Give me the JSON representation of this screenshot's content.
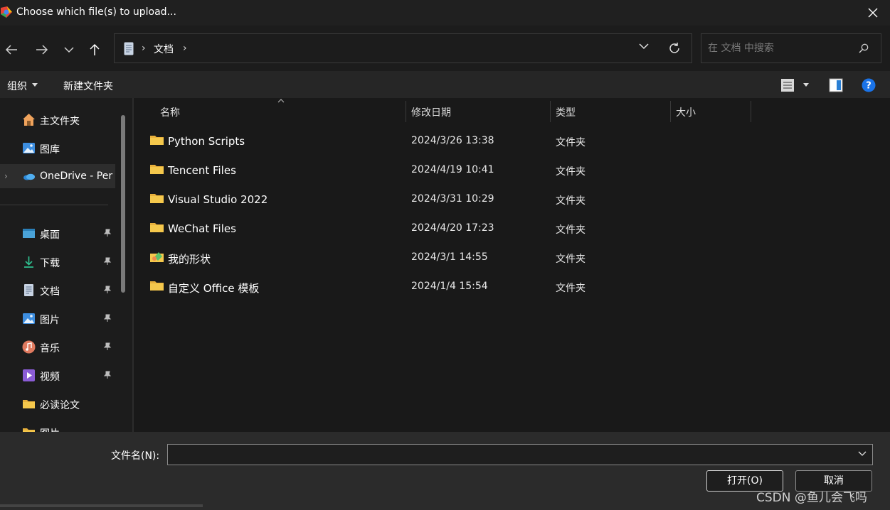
{
  "window": {
    "title": "Choose which file(s) to upload..."
  },
  "address": {
    "crumb": "文档",
    "sep": "›"
  },
  "search": {
    "placeholder": "在 文档 中搜索"
  },
  "toolbar": {
    "organize_label": "组织",
    "new_folder_label": "新建文件夹"
  },
  "sidebar": {
    "items": [
      {
        "label": "主文件夹",
        "icon": "home-icon"
      },
      {
        "label": "图库",
        "icon": "gallery-icon"
      },
      {
        "label": "OneDrive - Per",
        "icon": "onedrive-icon",
        "expander": "›"
      },
      {
        "label": "桌面",
        "icon": "desktop-icon"
      },
      {
        "label": "下载",
        "icon": "download-icon"
      },
      {
        "label": "文档",
        "icon": "document-icon"
      },
      {
        "label": "图片",
        "icon": "pictures-icon"
      },
      {
        "label": "音乐",
        "icon": "music-icon"
      },
      {
        "label": "视频",
        "icon": "video-icon"
      },
      {
        "label": "必读论文",
        "icon": "folder-icon"
      },
      {
        "label": "图片",
        "icon": "folder-icon"
      }
    ]
  },
  "columns": {
    "name": "名称",
    "date": "修改日期",
    "type": "类型",
    "size": "大小"
  },
  "files": [
    {
      "name": "Python Scripts",
      "date": "2024/3/26 13:38",
      "type": "文件夹",
      "icon": "folder-icon"
    },
    {
      "name": "Tencent Files",
      "date": "2024/4/19 10:41",
      "type": "文件夹",
      "icon": "folder-icon"
    },
    {
      "name": "Visual Studio 2022",
      "date": "2024/3/31 10:29",
      "type": "文件夹",
      "icon": "folder-icon"
    },
    {
      "name": "WeChat Files",
      "date": "2024/4/20 17:23",
      "type": "文件夹",
      "icon": "folder-icon"
    },
    {
      "name": "我的形状",
      "date": "2024/3/1 14:55",
      "type": "文件夹",
      "icon": "shapes-folder-icon"
    },
    {
      "name": "自定义 Office 模板",
      "date": "2024/1/4 15:54",
      "type": "文件夹",
      "icon": "folder-icon"
    }
  ],
  "bottom": {
    "filename_label": "文件名(N):",
    "filename_value": "",
    "open_label": "打开(O)",
    "cancel_label": "取消",
    "watermark": "CSDN @鱼儿会飞吗"
  },
  "colors": {
    "folder": "#f5c84c",
    "accent": "#0078d4"
  }
}
